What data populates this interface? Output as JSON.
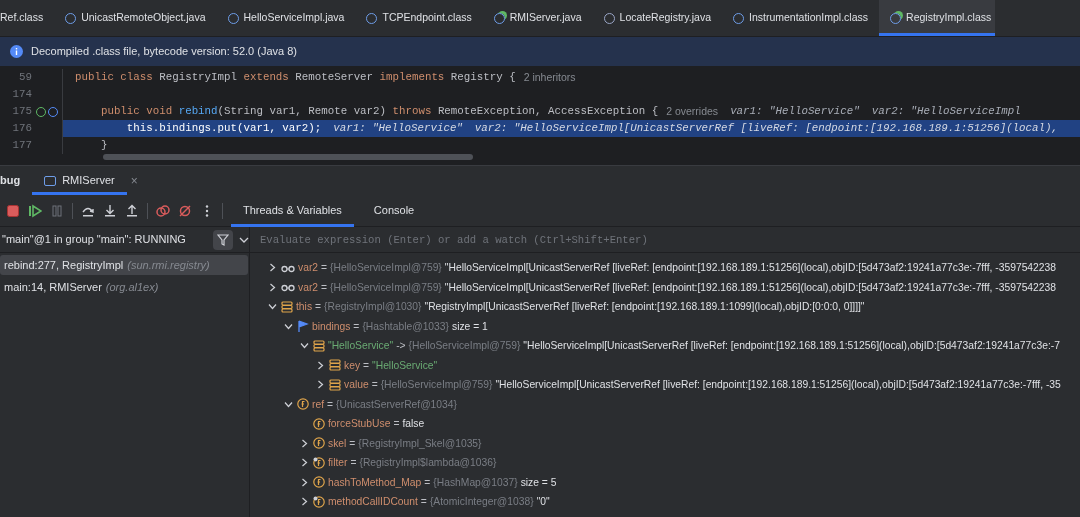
{
  "editor_tabs": [
    {
      "label": "Ref.class",
      "kind": "plain",
      "selected": false
    },
    {
      "label": "UnicastRemoteObject.java",
      "kind": "class",
      "selected": false
    },
    {
      "label": "HelloServiceImpl.java",
      "kind": "class",
      "selected": false
    },
    {
      "label": "TCPEndpoint.class",
      "kind": "class",
      "selected": false
    },
    {
      "label": "RMIServer.java",
      "kind": "runnable",
      "selected": false
    },
    {
      "label": "LocateRegistry.java",
      "kind": "class-alt",
      "selected": false
    },
    {
      "label": "InstrumentationImpl.class",
      "kind": "class",
      "selected": false
    },
    {
      "label": "RegistryImpl.class",
      "kind": "runnable",
      "selected": true
    }
  ],
  "banner": {
    "text": "Decompiled .class file, bytecode version: 52.0 (Java 8)"
  },
  "code_lines": [
    {
      "number": "59",
      "highlighted": false,
      "tokens": [
        {
          "kind": "keyword",
          "text": "public class "
        },
        {
          "kind": "plain",
          "text": "RegistryImpl "
        },
        {
          "kind": "keyword",
          "text": "extends "
        },
        {
          "kind": "plain",
          "text": "RemoteServer "
        },
        {
          "kind": "keyword",
          "text": "implements "
        },
        {
          "kind": "plain",
          "text": "Registry {"
        },
        {
          "kind": "hint",
          "text": "2 inheritors"
        }
      ]
    },
    {
      "number": "174",
      "highlighted": false
    },
    {
      "number": "175",
      "highlighted": false,
      "gutter": [
        {
          "kind": "override"
        },
        {
          "kind": "debug"
        }
      ],
      "tokens": [
        {
          "kind": "keyword",
          "text": "    public void "
        },
        {
          "kind": "method",
          "text": "rebind"
        },
        {
          "kind": "plain",
          "text": "(String var1, Remote var2) "
        },
        {
          "kind": "keyword",
          "text": "throws "
        },
        {
          "kind": "plain",
          "text": "RemoteException, AccessException {"
        },
        {
          "kind": "hint",
          "text": "2 overrides"
        },
        {
          "kind": "inlay",
          "text": "var1: \"HelloService\""
        },
        {
          "kind": "inlay",
          "text": "var2: \"HelloServiceImpl"
        }
      ]
    },
    {
      "number": "176",
      "highlighted": true,
      "tokens": [
        {
          "kind": "keyword",
          "text": "        this"
        },
        {
          "kind": "plain",
          "text": "."
        },
        {
          "kind": "field",
          "text": "bindings"
        },
        {
          "kind": "plain",
          "text": ".put(var1, var2);"
        },
        {
          "kind": "inlay",
          "text": "var1: \"HelloService\""
        },
        {
          "kind": "inlay",
          "text": "var2: \"HelloServiceImpl[UnicastServerRef [liveRef: [endpoint:[192.168.189.1:51256](local),"
        }
      ]
    },
    {
      "number": "177",
      "highlighted": false,
      "tokens": [
        {
          "kind": "plain",
          "text": "    }"
        }
      ]
    }
  ],
  "debug_window": {
    "tabs": [
      {
        "label": "bug",
        "selected": false
      },
      {
        "label": "RMIServer",
        "selected": true,
        "close": "×"
      }
    ],
    "toolbar": [
      {
        "kind": "stop"
      },
      {
        "kind": "resume"
      },
      {
        "kind": "pause"
      },
      {
        "kind": "step-over"
      },
      {
        "kind": "step-into"
      },
      {
        "kind": "step-out"
      },
      {
        "kind": "breakpoints"
      },
      {
        "kind": "mute"
      },
      {
        "kind": "more"
      }
    ],
    "view_tabs": [
      {
        "label": "Threads & Variables",
        "selected": true
      },
      {
        "label": "Console",
        "selected": false
      }
    ],
    "thread": "\"main\"@1 in group \"main\": RUNNING",
    "frames": [
      {
        "method": "rebind:277, RegistryImpl",
        "package": "(sun.rmi.registry)",
        "selected": true
      },
      {
        "method": "main:14, RMIServer",
        "package": "(org.al1ex)",
        "selected": false
      }
    ],
    "evaluate": {
      "placeholder": "Evaluate expression (Enter) or add a watch (Ctrl+Shift+Enter)"
    },
    "variables": [
      {
        "kind": "watch",
        "expandable": true,
        "expanded": false,
        "name": "var2",
        "name_is_string": false,
        "sep": "=",
        "type": "{HelloServiceImpl@759}",
        "value": "\"HelloServiceImpl[UnicastServerRef [liveRef: [endpoint:[192.168.189.1:51256](local),objID:[5d473af2:19241a77c3e:-7fff, -3597542238",
        "value_is_string": false
      },
      {
        "kind": "watch",
        "expandable": true,
        "expanded": false,
        "name": "var2",
        "name_is_string": false,
        "sep": "=",
        "type": "{HelloServiceImpl@759}",
        "value": "\"HelloServiceImpl[UnicastServerRef [liveRef: [endpoint:[192.168.189.1:51256](local),objID:[5d473af2:19241a77c3e:-7fff, -3597542238",
        "value_is_string": false
      },
      {
        "kind": "object",
        "expandable": true,
        "expanded": true,
        "name": "this",
        "name_is_string": false,
        "sep": "=",
        "type": "{RegistryImpl@1030}",
        "value": "\"RegistryImpl[UnicastServerRef [liveRef: [endpoint:[192.168.189.1:1099](local),objID:[0:0:0, 0]]]]\"",
        "value_is_string": false,
        "children": [
          {
            "kind": "flag",
            "expandable": true,
            "expanded": true,
            "name": "bindings",
            "name_is_string": false,
            "sep": "=",
            "type": "{Hashtable@1033}",
            "value": "size = 1",
            "value_is_string": false,
            "children": [
              {
                "kind": "object",
                "expandable": true,
                "expanded": true,
                "name": "\"HelloService\"",
                "name_is_string": true,
                "sep": "->",
                "type": "{HelloServiceImpl@759}",
                "value": "\"HelloServiceImpl[UnicastServerRef [liveRef: [endpoint:[192.168.189.1:51256](local),objID:[5d473af2:19241a77c3e:-7",
                "value_is_string": false,
                "children": [
                  {
                    "kind": "object",
                    "expandable": true,
                    "expanded": false,
                    "name": "key",
                    "name_is_string": false,
                    "sep": "=",
                    "value": "\"HelloService\"",
                    "value_is_string": true
                  },
                  {
                    "kind": "object",
                    "expandable": true,
                    "expanded": false,
                    "name": "value",
                    "name_is_string": false,
                    "sep": "=",
                    "type": "{HelloServiceImpl@759}",
                    "value": "\"HelloServiceImpl[UnicastServerRef [liveRef: [endpoint:[192.168.189.1:51256](local),objID:[5d473af2:19241a77c3e:-7fff, -35",
                    "value_is_string": false
                  }
                ]
              }
            ]
          },
          {
            "kind": "field",
            "expandable": true,
            "expanded": true,
            "name": "ref",
            "name_is_string": false,
            "sep": "=",
            "type": "{UnicastServerRef@1034}",
            "children": [
              {
                "kind": "field",
                "expandable": false,
                "name": "forceStubUse",
                "name_is_string": false,
                "sep": "=",
                "value": "false",
                "value_is_string": false
              },
              {
                "kind": "field",
                "expandable": true,
                "expanded": false,
                "name": "skel",
                "name_is_string": false,
                "sep": "=",
                "type": "{RegistryImpl_Skel@1035}"
              },
              {
                "kind": "field-static",
                "expandable": true,
                "expanded": false,
                "name": "filter",
                "name_is_string": false,
                "sep": "=",
                "type": "{RegistryImpl$lambda@1036}"
              },
              {
                "kind": "field",
                "expandable": true,
                "expanded": false,
                "name": "hashToMethod_Map",
                "name_is_string": false,
                "sep": "=",
                "type": "{HashMap@1037}",
                "value": "size = 5",
                "value_is_string": false
              },
              {
                "kind": "field-static",
                "expandable": true,
                "expanded": false,
                "name": "methodCallIDCount",
                "name_is_string": false,
                "sep": "=",
                "type": "{AtomicInteger@1038}",
                "value": "\"0\"",
                "value_is_string": false
              }
            ]
          }
        ]
      }
    ]
  }
}
